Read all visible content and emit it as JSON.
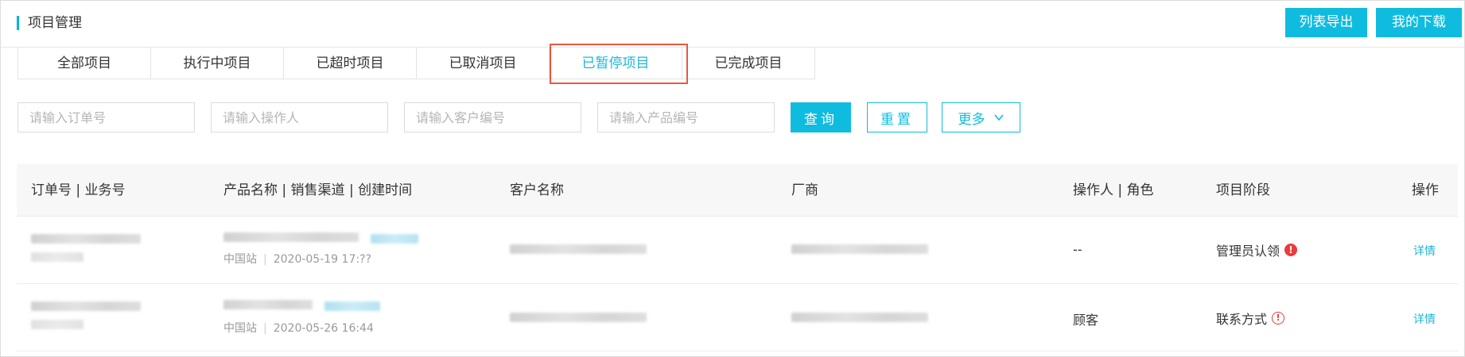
{
  "header": {
    "title": "项目管理",
    "export_label": "列表导出",
    "download_label": "我的下载"
  },
  "tabs": [
    {
      "label": "全部项目",
      "active": false
    },
    {
      "label": "执行中项目",
      "active": false
    },
    {
      "label": "已超时项目",
      "active": false
    },
    {
      "label": "已取消项目",
      "active": false
    },
    {
      "label": "已暂停项目",
      "active": true
    },
    {
      "label": "已完成项目",
      "active": false
    }
  ],
  "filters": {
    "order_placeholder": "请输入订单号",
    "operator_placeholder": "请输入操作人",
    "customer_placeholder": "请输入客户编号",
    "product_placeholder": "请输入产品编号",
    "query_label": "查询",
    "reset_label": "重置",
    "more_label": "更多"
  },
  "table": {
    "columns": [
      "订单号 | 业务号",
      "产品名称 | 销售渠道 | 创建时间",
      "客户名称",
      "厂商",
      "操作人 | 角色",
      "项目阶段",
      "操作"
    ],
    "rows": [
      {
        "channel": "中国站",
        "created": "2020-05-19 17:??",
        "operator": "--",
        "stage": "管理员认领",
        "alert": "!",
        "action": "详情"
      },
      {
        "channel": "中国站",
        "created": "2020-05-26 16:44",
        "operator": "顾客",
        "stage": "联系方式",
        "alert": "!",
        "action": "详情"
      }
    ]
  },
  "colors": {
    "accent": "#0fbce0",
    "alert": "#ee3a3a",
    "highlight_border": "#e9583d"
  }
}
